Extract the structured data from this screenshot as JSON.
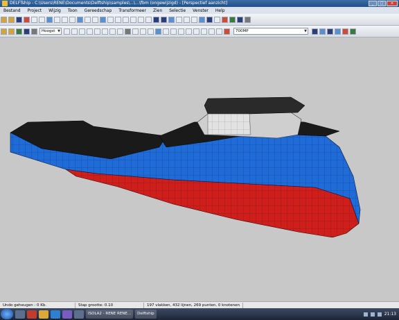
{
  "window": {
    "title": "DELFTship - C:\\Users\\RENE\\Documents\\Delftship\\samples\\...\\...\\fbm (ongewijzigd) - [Perspectief aanzicht]"
  },
  "menu": [
    "Bestand",
    "Project",
    "Wijzig",
    "Toon",
    "Gereedschap",
    "Transformeer",
    "Zien",
    "Selectie",
    "Venster",
    "Help"
  ],
  "toolbar": {
    "view_combo": "Hoogst",
    "zoom_combo": "700MP"
  },
  "status": {
    "undo": "Undo geheugen : 0 Kb.",
    "step": "Stap grootte: 0.10",
    "counts": "197 vlakken, 432 lijnen, 269 punten, 0 knotenen"
  },
  "taskbar": {
    "tasks": [
      "ISOLA2 - RENE RENE...",
      "Delftship"
    ],
    "clock": "21:13"
  },
  "colors": {
    "hull_blue": "#1f6bd8",
    "hull_red": "#d01f1a",
    "deck": "#1a1a1a",
    "superstructure": "#cfcfcf",
    "background": "#c8c8c8"
  }
}
